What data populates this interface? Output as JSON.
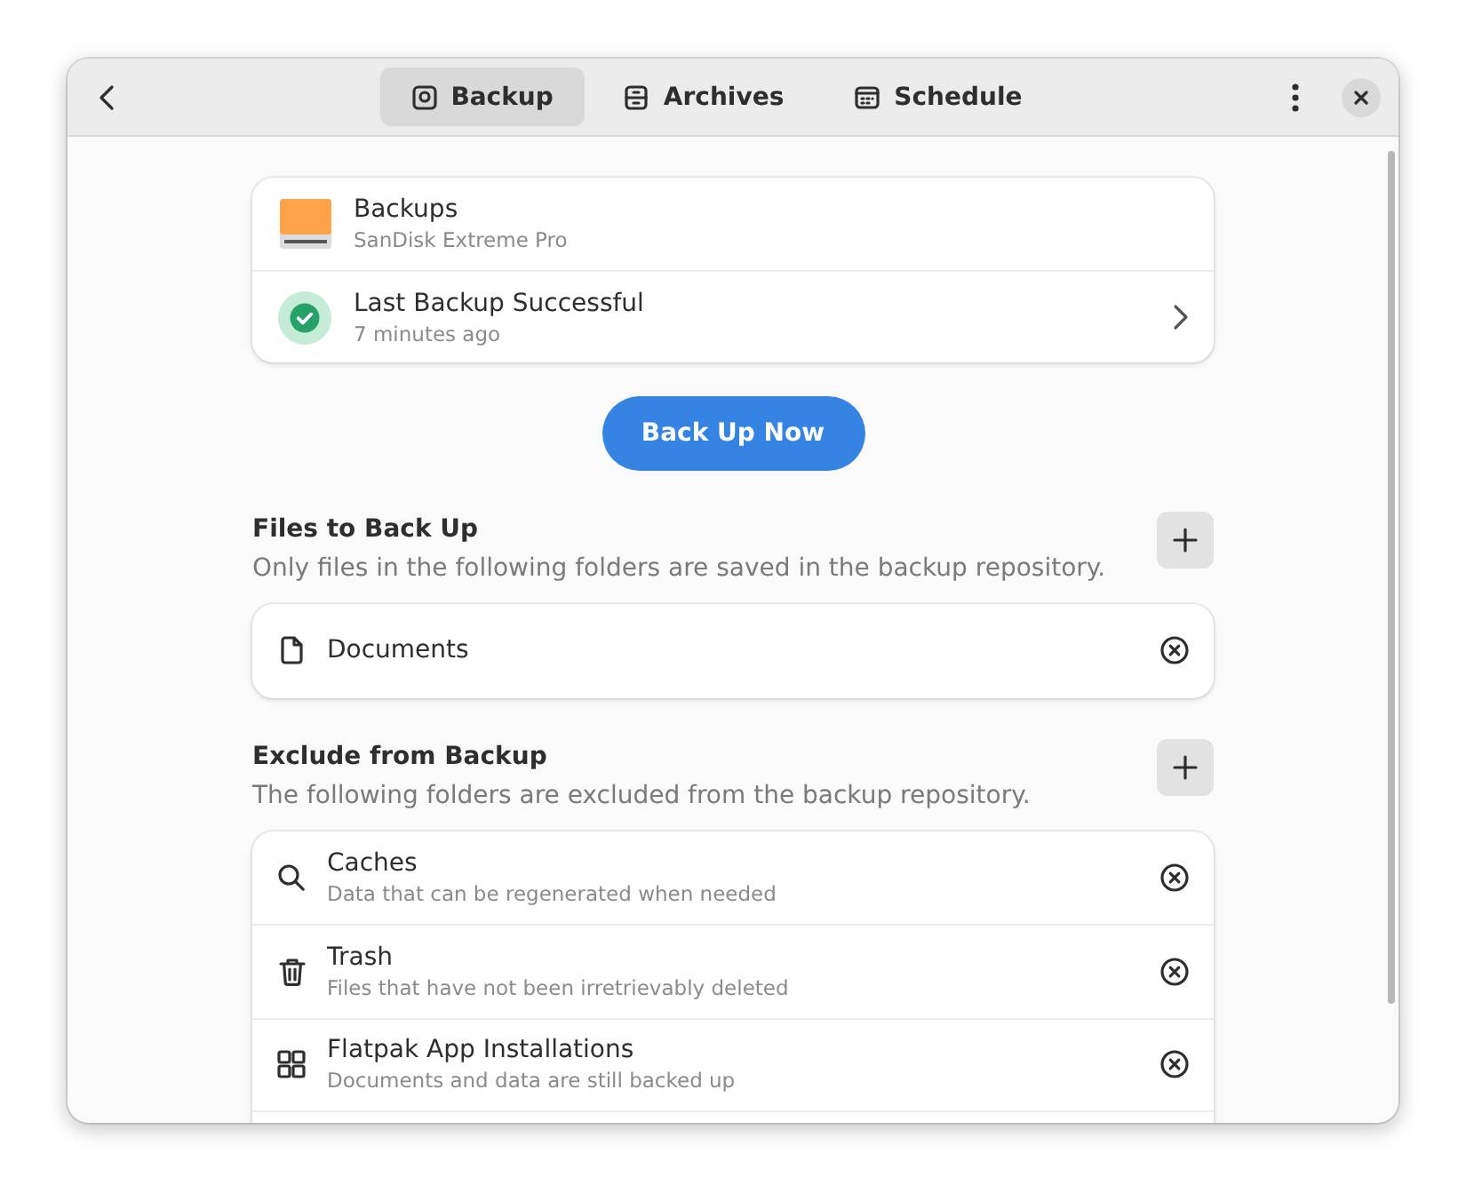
{
  "header": {
    "tabs": [
      {
        "label": "Backup",
        "selected": true
      },
      {
        "label": "Archives",
        "selected": false
      },
      {
        "label": "Schedule",
        "selected": false
      }
    ]
  },
  "status": [
    {
      "kind": "drive",
      "title": "Backups",
      "subtitle": "SanDisk Extreme Pro"
    },
    {
      "kind": "success",
      "title": "Last Backup Successful",
      "subtitle": "7 minutes ago"
    }
  ],
  "primary_button": "Back Up Now",
  "sections": [
    {
      "title": "Files to Back Up",
      "description": "Only files in the following folders are saved in the backup repository.",
      "items": [
        {
          "title": "Documents"
        }
      ]
    },
    {
      "title": "Exclude from Backup",
      "description": "The following folders are excluded from the backup repository.",
      "items": [
        {
          "title": "Caches",
          "subtitle": "Data that can be regenerated when needed"
        },
        {
          "title": "Trash",
          "subtitle": "Files that have not been irretrievably deleted"
        },
        {
          "title": "Flatpak App Installations",
          "subtitle": "Documents and data are still backed up"
        }
      ]
    }
  ]
}
